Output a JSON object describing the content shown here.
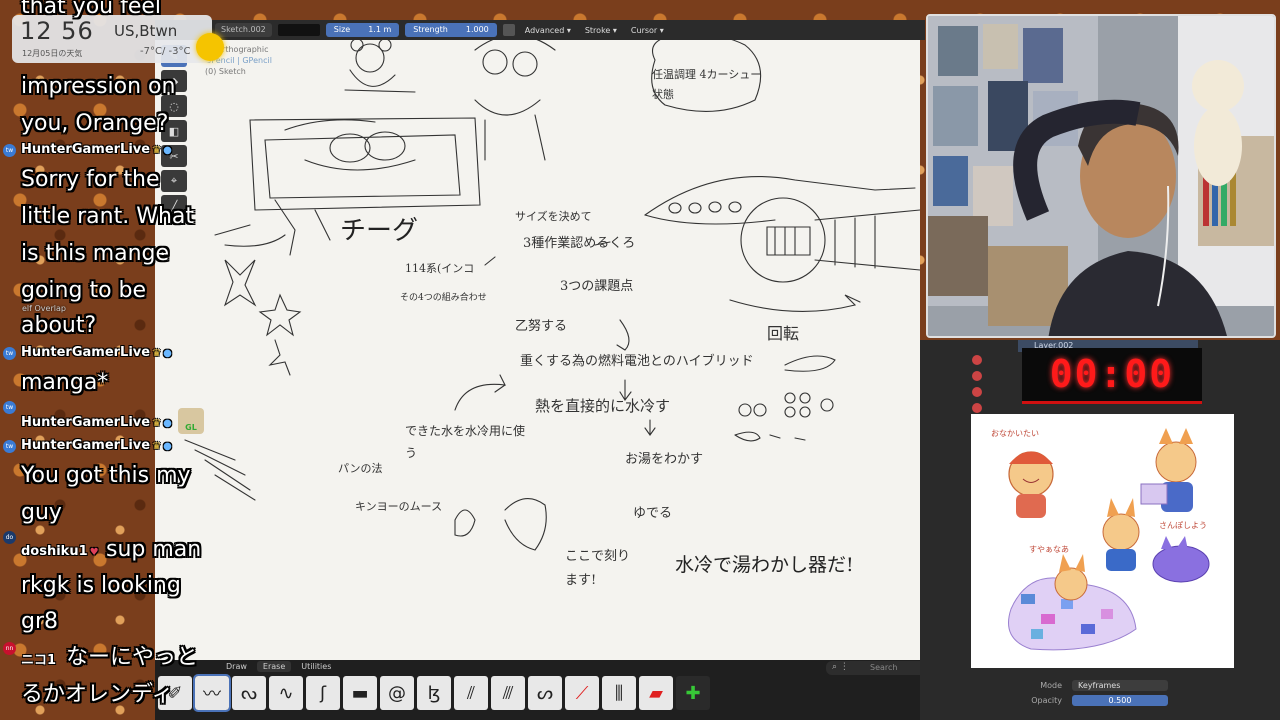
{
  "clock": {
    "time": "12 56",
    "location": "US,Btwn",
    "date": "12月05日の天気",
    "temperature": "-7°C/ -3°C"
  },
  "viewport": {
    "header": {
      "layer_field": "Sketch.002",
      "size_label": "Size",
      "size_value": "1.1 m",
      "strength_label": "Strength",
      "strength_value": "1.000",
      "dropdowns": [
        "Advanced",
        "Stroke",
        "Cursor"
      ]
    },
    "overlay": {
      "view": "ht Orthographic",
      "object": "GPencil | GPencil",
      "frame": "(0) Sketch"
    },
    "sketch_notes": {
      "n1": "サイズを決めて",
      "n2": "3種作業認めるくろ",
      "n3": "114系(インコ",
      "n4": "その4つの組み合わせ",
      "n5": "3つの課題点",
      "n6": "乙努する",
      "n7": "重くする為の燃料電池とのハイブリッド",
      "n8": "熱を直接的に水冷す",
      "n9": "できた水を水冷用に使う",
      "n10": "お湯をわかす",
      "n11": "ゆでる",
      "n12": "ここで刻ります!",
      "n13": "水冷で湯わかし器だ!",
      "n14": "回転",
      "n15": "チーグ",
      "n16": "任温調理 4カーシュー状態",
      "n17": "パンの法",
      "n18": "キンヨーのムース"
    },
    "context_label": "elf Overlap"
  },
  "bottom_bar": {
    "tabs": [
      "Draw",
      "Erase",
      "Utilities"
    ],
    "search_placeholder": "Search"
  },
  "right_panel": {
    "layer_name": "Layer.002",
    "timer": "00:00",
    "mode_label": "Mode",
    "mode_value": "Keyframes",
    "opacity_label": "Opacity",
    "opacity_value": "0.500"
  },
  "reference": {
    "label1": "おなかいたい",
    "label2": "さんぽしよう",
    "label3": "すやぁなあ"
  },
  "chat": {
    "top_text": "that you feel",
    "messages": [
      {
        "text": "impression on"
      },
      {
        "text": "you, Orange?"
      },
      {
        "user": "HunterGamerLive"
      },
      {
        "text": "Sorry for the"
      },
      {
        "text": "little rant. What"
      },
      {
        "text": "is this mange"
      },
      {
        "text": "going to be"
      },
      {
        "text": "about?"
      },
      {
        "user": "HunterGamerLive"
      },
      {
        "text": "manga*"
      },
      {
        "user": "HunterGamerLive"
      },
      {
        "user": "HunterGamerLive"
      },
      {
        "text": "You got this my"
      },
      {
        "text": "guy"
      },
      {
        "user": "doshiku1",
        "inline": "sup man"
      },
      {
        "text": "rkgk is looking"
      },
      {
        "text": "gr8"
      },
      {
        "user": "ニコ1",
        "inline": "なーにやっと"
      },
      {
        "text": "るかオレンディ"
      }
    ]
  },
  "colors": {
    "accent": "#4a72b8",
    "timer_red": "#ff1a1a",
    "canvas": "#f4f3ef",
    "badge_gold": "#ffd24a"
  }
}
